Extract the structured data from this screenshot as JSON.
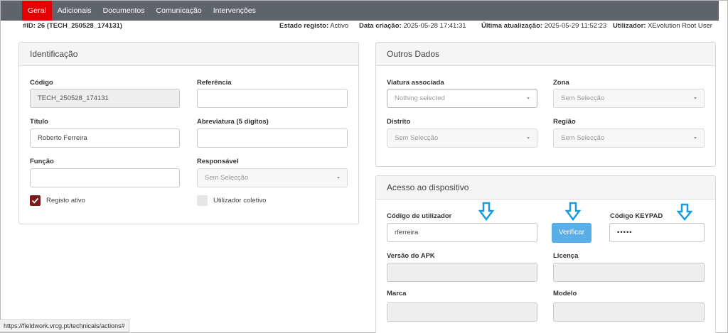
{
  "tabs": [
    {
      "label": "Geral",
      "active": true
    },
    {
      "label": "Adicionais",
      "active": false
    },
    {
      "label": "Documentos",
      "active": false
    },
    {
      "label": "Comunicação",
      "active": false
    },
    {
      "label": "Intervenções",
      "active": false
    }
  ],
  "info": {
    "id": "#ID: 26 (TECH_250528_174131)",
    "estado_label": "Estado registo:",
    "estado_value": "Activo",
    "data_criacao_label": "Data criação:",
    "data_criacao_value": "2025-05-28 17:41:31",
    "ultima_label": "Última atualização:",
    "ultima_value": "2025-05-29 11:52:23",
    "utilizador_label": "Utilizador:",
    "utilizador_value": "XEvolution Root User"
  },
  "identificacao": {
    "title": "Identificação",
    "codigo_label": "Código",
    "codigo_value": "TECH_250528_174131",
    "referencia_label": "Referência",
    "referencia_value": "",
    "titulo_label": "Título",
    "titulo_value": "Roberto Ferreira",
    "abreviatura_label": "Abreviatura (5 digitos)",
    "abreviatura_value": "",
    "funcao_label": "Função",
    "funcao_value": "",
    "responsavel_label": "Responsável",
    "responsavel_value": "Sem Selecção",
    "registo_ativo_label": "Registo ativo",
    "registo_ativo_checked": true,
    "utilizador_coletivo_label": "Utilizador coletivo",
    "utilizador_coletivo_checked": false
  },
  "outros": {
    "title": "Outros Dados",
    "viatura_label": "Viatura associada",
    "viatura_value": "Nothing selected",
    "zona_label": "Zona",
    "zona_value": "Sem Selecção",
    "distrito_label": "Distrito",
    "distrito_value": "Sem Selecção",
    "regiao_label": "Região",
    "regiao_value": "Sem Selecção"
  },
  "acesso": {
    "title": "Acesso ao dispositivo",
    "codigo_utilizador_label": "Código de utilizador",
    "codigo_utilizador_value": "rferreira",
    "verificar_label": "Verificar",
    "codigo_keypad_label": "Código KEYPAD",
    "codigo_keypad_value": "•••••",
    "versao_apk_label": "Versão do APK",
    "versao_apk_value": "",
    "licenca_label": "Licença",
    "licenca_value": "",
    "marca_label": "Marca",
    "marca_value": "",
    "modelo_label": "Modelo",
    "modelo_value": ""
  },
  "status_url": "https://fieldwork.vrcg.pt/technicals/actions#",
  "colors": {
    "tabbar": "#5f636a",
    "active_tab": "#e20000",
    "checkbox_checked": "#7b1c1c",
    "verify_button": "#5aaee8",
    "annotation_arrow": "#1a9be0"
  },
  "icons": [
    "down-arrow-annotation-icon",
    "checkmark-icon",
    "caret-down-icon"
  ]
}
